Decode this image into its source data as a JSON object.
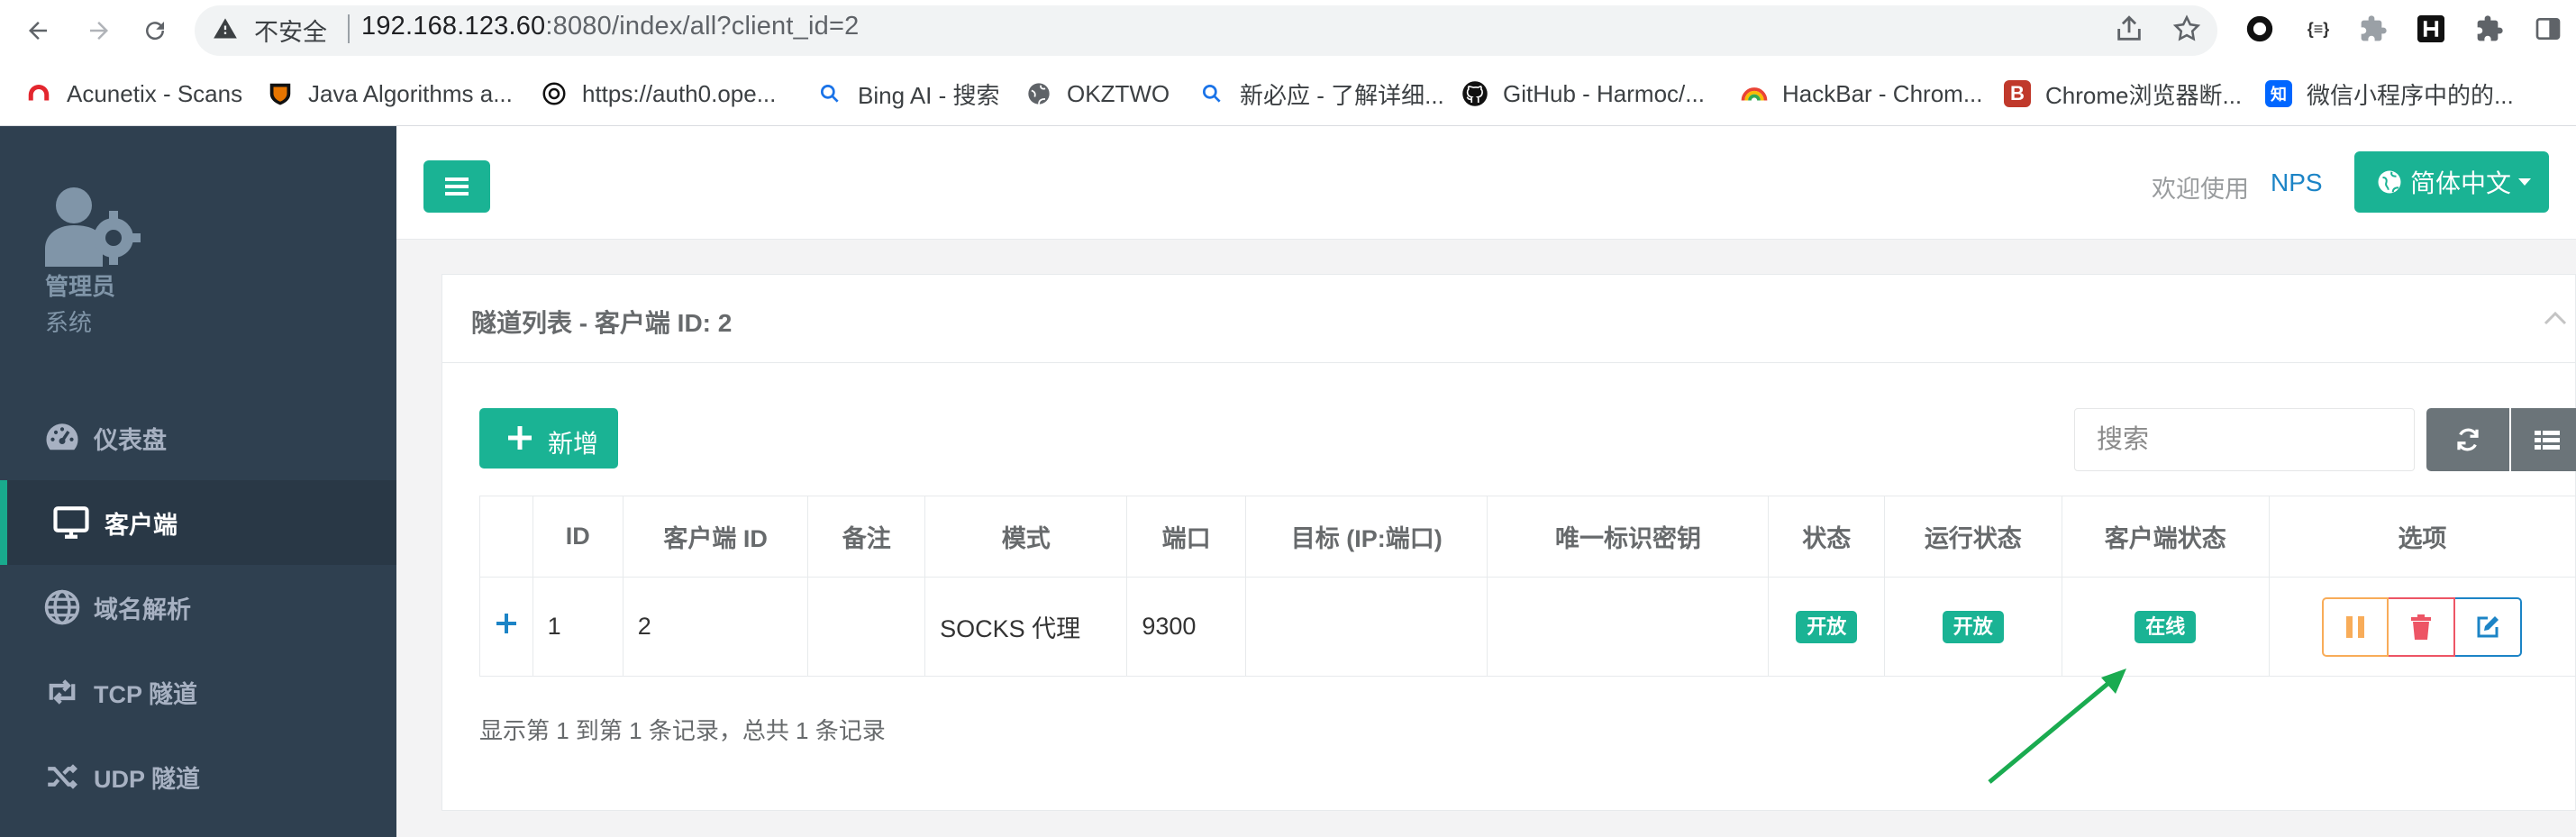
{
  "browser": {
    "insecure_label": "不安全",
    "url_host": "192.168.123.60",
    "url_rest": ":8080/index/all?client_id=2",
    "bookmarks": [
      {
        "label": "Acunetix - Scans",
        "icon": "acunetix-icon",
        "color": "#e3262e"
      },
      {
        "label": "Java Algorithms a...",
        "icon": "princeton-shield-icon",
        "color": "#e77500"
      },
      {
        "label": "https://auth0.ope...",
        "icon": "openai-icon",
        "color": "#000000"
      },
      {
        "label": "Bing AI - 搜索",
        "icon": "search-icon",
        "color": "#1a73e8"
      },
      {
        "label": "OKZTWO",
        "icon": "globe-icon",
        "color": "#5f6368"
      },
      {
        "label": "新必应 - 了解详细...",
        "icon": "search-icon",
        "color": "#1a73e8"
      },
      {
        "label": "GitHub - Harmoc/...",
        "icon": "github-icon",
        "color": "#000000"
      },
      {
        "label": "HackBar - Chrom...",
        "icon": "rainbow-icon",
        "color": "#ea4335"
      },
      {
        "label": "Chrome浏览器断...",
        "icon": "b-logo-icon",
        "color": "#c0392b"
      },
      {
        "label": "微信小程序中的的...",
        "icon": "zhihu-icon",
        "color": "#0066ff"
      }
    ]
  },
  "sidebar": {
    "profile_name": "管理员",
    "profile_role": "系统",
    "items": [
      {
        "label": "仪表盘",
        "icon": "dashboard-icon",
        "active": false
      },
      {
        "label": "客户端",
        "icon": "desktop-icon",
        "active": true
      },
      {
        "label": "域名解析",
        "icon": "globe-icon",
        "active": false
      },
      {
        "label": "TCP 隧道",
        "icon": "retweet-icon",
        "active": false
      },
      {
        "label": "UDP 隧道",
        "icon": "random-icon",
        "active": false
      }
    ]
  },
  "header": {
    "welcome": "欢迎使用",
    "brand": "NPS",
    "language": "简体中文"
  },
  "panel": {
    "title": "隧道列表 - 客户端 ID: 2",
    "add_label": "新增",
    "search_placeholder": "搜索",
    "columns": [
      "",
      "ID",
      "客户端 ID",
      "备注",
      "模式",
      "端口",
      "目标 (IP:端口)",
      "唯一标识密钥",
      "状态",
      "运行状态",
      "客户端状态",
      "选项"
    ],
    "rows": [
      {
        "id": "1",
        "client_id": "2",
        "remark": "",
        "mode": "SOCKS 代理",
        "port": "9300",
        "target": "",
        "password": "",
        "status": "开放",
        "run_status": "开放",
        "client_status": "在线"
      }
    ],
    "record_info": "显示第 1 到第 1 条记录，总共 1 条记录"
  },
  "colors": {
    "primary": "#1ab394",
    "sidebar_bg": "#2f4050",
    "link": "#1c84c6",
    "warning": "#f8ac59",
    "danger": "#ed5565",
    "annotation_arrow": "#1aab50"
  }
}
